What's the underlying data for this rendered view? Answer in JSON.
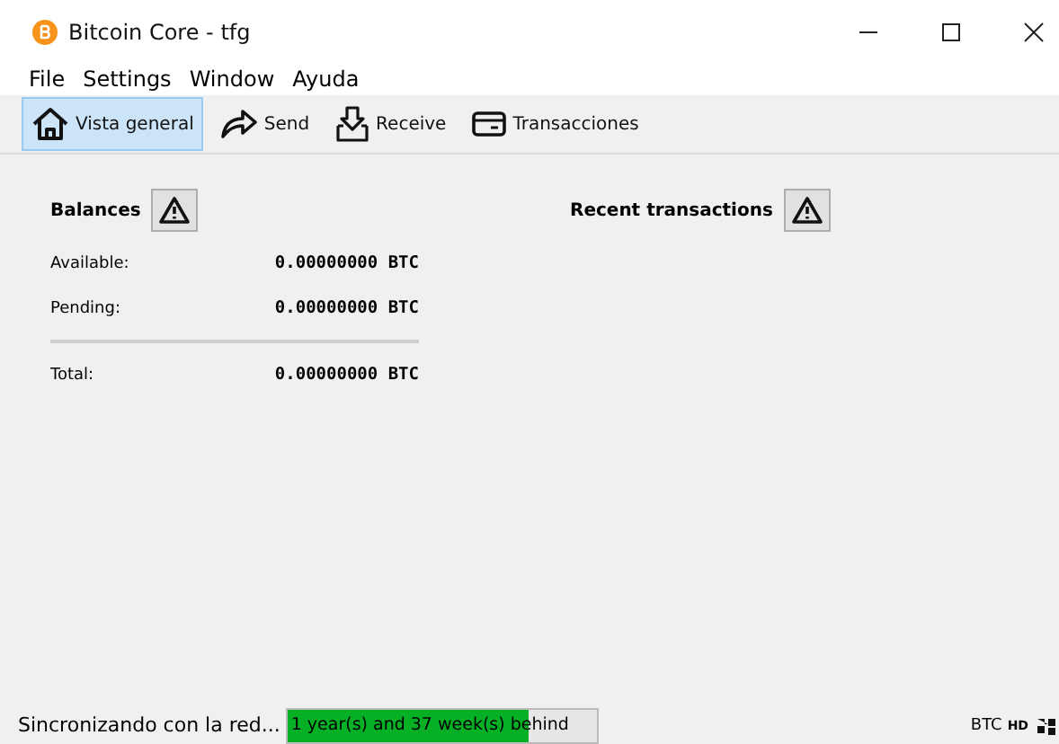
{
  "window": {
    "title": "Bitcoin Core - tfg"
  },
  "menu": [
    "File",
    "Settings",
    "Window",
    "Ayuda"
  ],
  "tabs": [
    {
      "label": "Vista general",
      "selected": true
    },
    {
      "label": "Send",
      "selected": false
    },
    {
      "label": "Receive",
      "selected": false
    },
    {
      "label": "Transacciones",
      "selected": false
    }
  ],
  "balances": {
    "title": "Balances",
    "rows": [
      {
        "label": "Available:",
        "value": "0.00000000 BTC"
      },
      {
        "label": "Pending:",
        "value": "0.00000000 BTC"
      }
    ],
    "total": {
      "label": "Total:",
      "value": "0.00000000 BTC"
    }
  },
  "recent": {
    "title": "Recent transactions"
  },
  "status_bar": {
    "message": "Sincronizando con la red...",
    "progress": {
      "text": "1 year(s) and 37 week(s) behind",
      "level": 0.78
    },
    "unit": "BTC",
    "hd": "HD"
  }
}
